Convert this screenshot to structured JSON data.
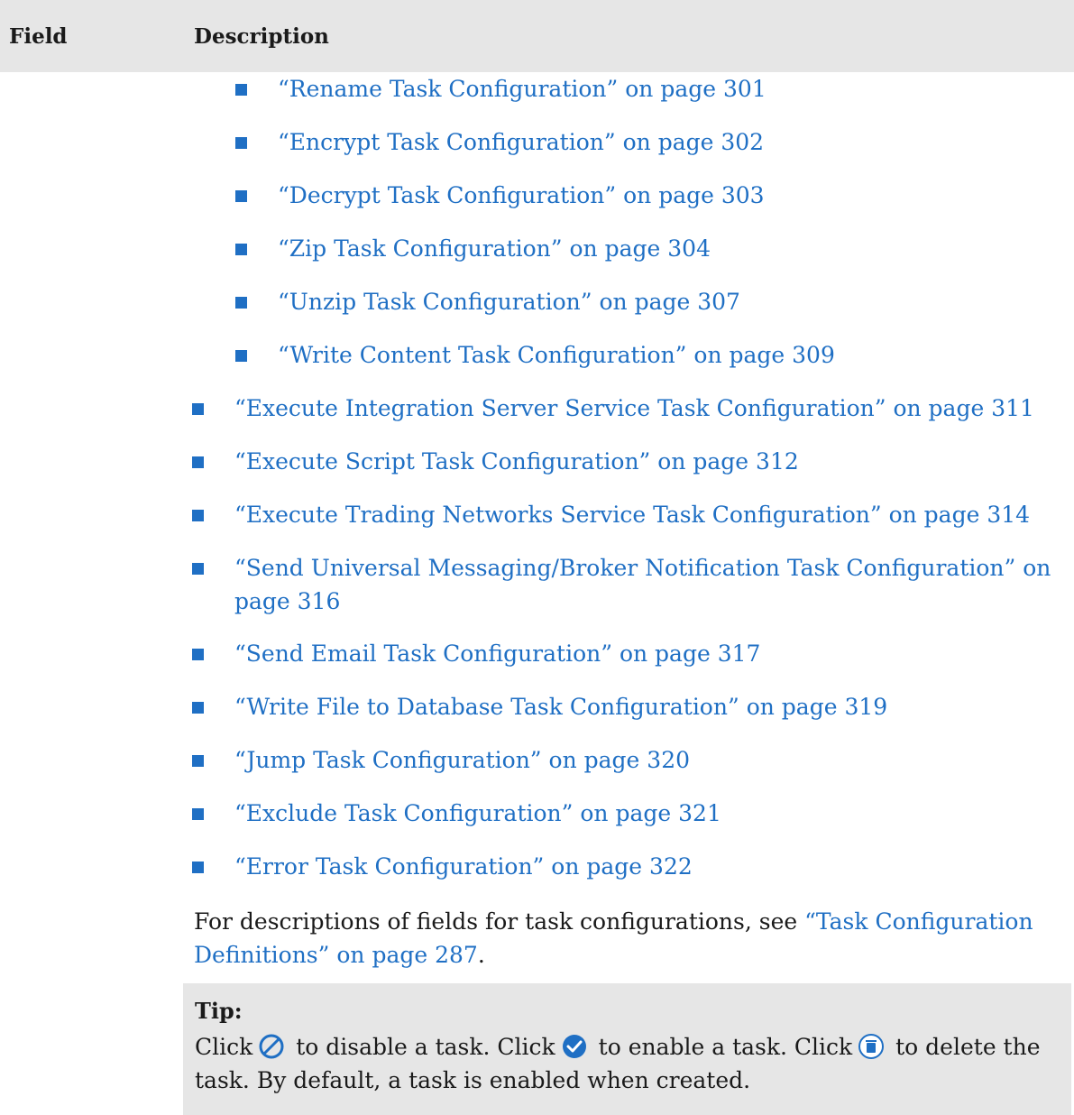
{
  "table_header": {
    "field": "Field",
    "description": "Description"
  },
  "nested_items": [
    {
      "label": "“Rename Task Configuration” on page 301"
    },
    {
      "label": "“Encrypt Task Configuration” on page 302"
    },
    {
      "label": "“Decrypt Task Configuration” on page 303"
    },
    {
      "label": "“Zip Task Configuration” on page 304"
    },
    {
      "label": "“Unzip Task Configuration” on page 307"
    },
    {
      "label": "“Write Content Task Configuration” on page 309"
    }
  ],
  "items": [
    {
      "label": "“Execute Integration Server Service Task Configuration” on page 311"
    },
    {
      "label": "“Execute Script Task Configuration” on page 312"
    },
    {
      "label": "“Execute Trading Networks Service Task Configuration” on page 314"
    },
    {
      "label": "“Send Universal Messaging/Broker Notification Task Configuration” on page 316"
    },
    {
      "label": "“Send Email Task Configuration” on page 317"
    },
    {
      "label": "“Write File to Database Task Configuration” on page 319"
    },
    {
      "label": "“Jump Task Configuration” on page 320"
    },
    {
      "label": "“Exclude Task Configuration” on page 321"
    },
    {
      "label": "“Error Task Configuration” on page 322"
    }
  ],
  "paragraph": {
    "text": "For descriptions of fields for task configurations, see ",
    "link": "“Task Configuration Definitions” on page 287",
    "end": "."
  },
  "tip": {
    "label": "Tip:",
    "click": "Click",
    "disable_text": " to disable a task. Click",
    "enable_text": " to enable a task. Click",
    "delete_text": " to delete the task. By default, a task is enabled when created."
  },
  "colors": {
    "link": "#1f6fc4",
    "header_bg": "#e6e6e6",
    "tip_bg": "#e6e6e6"
  },
  "icons": {
    "disable": "disable-icon",
    "enable": "enable-check-icon",
    "delete": "delete-icon"
  }
}
